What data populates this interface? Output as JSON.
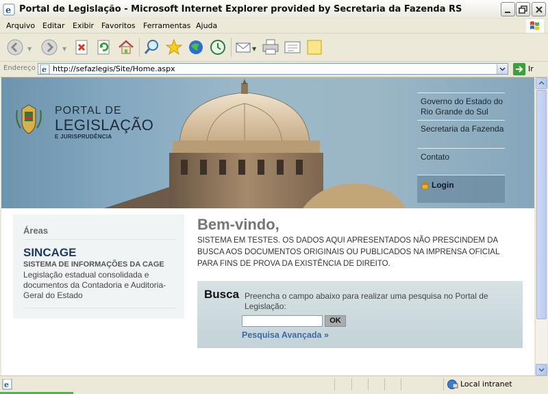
{
  "window": {
    "title": "Portal de Legislação - Microsoft Internet Explorer provided by Secretaria da Fazenda RS"
  },
  "menu": [
    "Arquivo",
    "Editar",
    "Exibir",
    "Favoritos",
    "Ferramentas",
    "Ajuda"
  ],
  "toolbar": {
    "icons": [
      "back-icon",
      "forward-icon",
      "stop-icon",
      "refresh-icon",
      "home-icon",
      "search-icon",
      "favorites-icon",
      "media-icon",
      "history-icon",
      "mail-icon",
      "print-icon",
      "edit-icon",
      "discuss-icon"
    ]
  },
  "address": {
    "label": "Endereço",
    "url": "http://sefazlegis/Site/Home.aspx",
    "go_label": "Ir"
  },
  "page": {
    "logo": {
      "line1": "PORTAL DE",
      "line2": "LEGISLAÇÃO",
      "line3": "E JURISPRUDÊNCIA"
    },
    "nav": [
      "Governo do Estado do Rio Grande do Sul",
      "Secretaria da Fazenda",
      "Contato"
    ],
    "login_label": "Login",
    "sidebar": {
      "heading": "Áreas",
      "item_title": "SINCAGE",
      "item_subtitle": "SISTEMA DE INFORMAÇÕES DA CAGE",
      "item_desc": "Legislação estadual consolidada e documentos da Contadoria e Auditoria-Geral do Estado"
    },
    "welcome": "Bem-vindo,",
    "notice": "SISTEMA EM TESTES. OS DADOS AQUI APRESENTADOS NÃO PRESCINDEM DA BUSCA AOS DOCUMENTOS ORIGINAIS OU PUBLICADOS NA IMPRENSA OFICIAL PARA FINS DE PROVA DA EXISTÊNCIA DE DIREITO.",
    "search": {
      "title": "Busca",
      "help": "Preencha o campo abaixo para realizar uma pesquisa no Portal de Legislação:",
      "value": "",
      "button": "OK",
      "advanced_link": "Pesquisa Avançada »"
    }
  },
  "status": {
    "zone": "Local intranet"
  },
  "colors": {
    "link": "#3f6aa7",
    "sincage": "#1c3b6b",
    "welcome": "#757575"
  }
}
